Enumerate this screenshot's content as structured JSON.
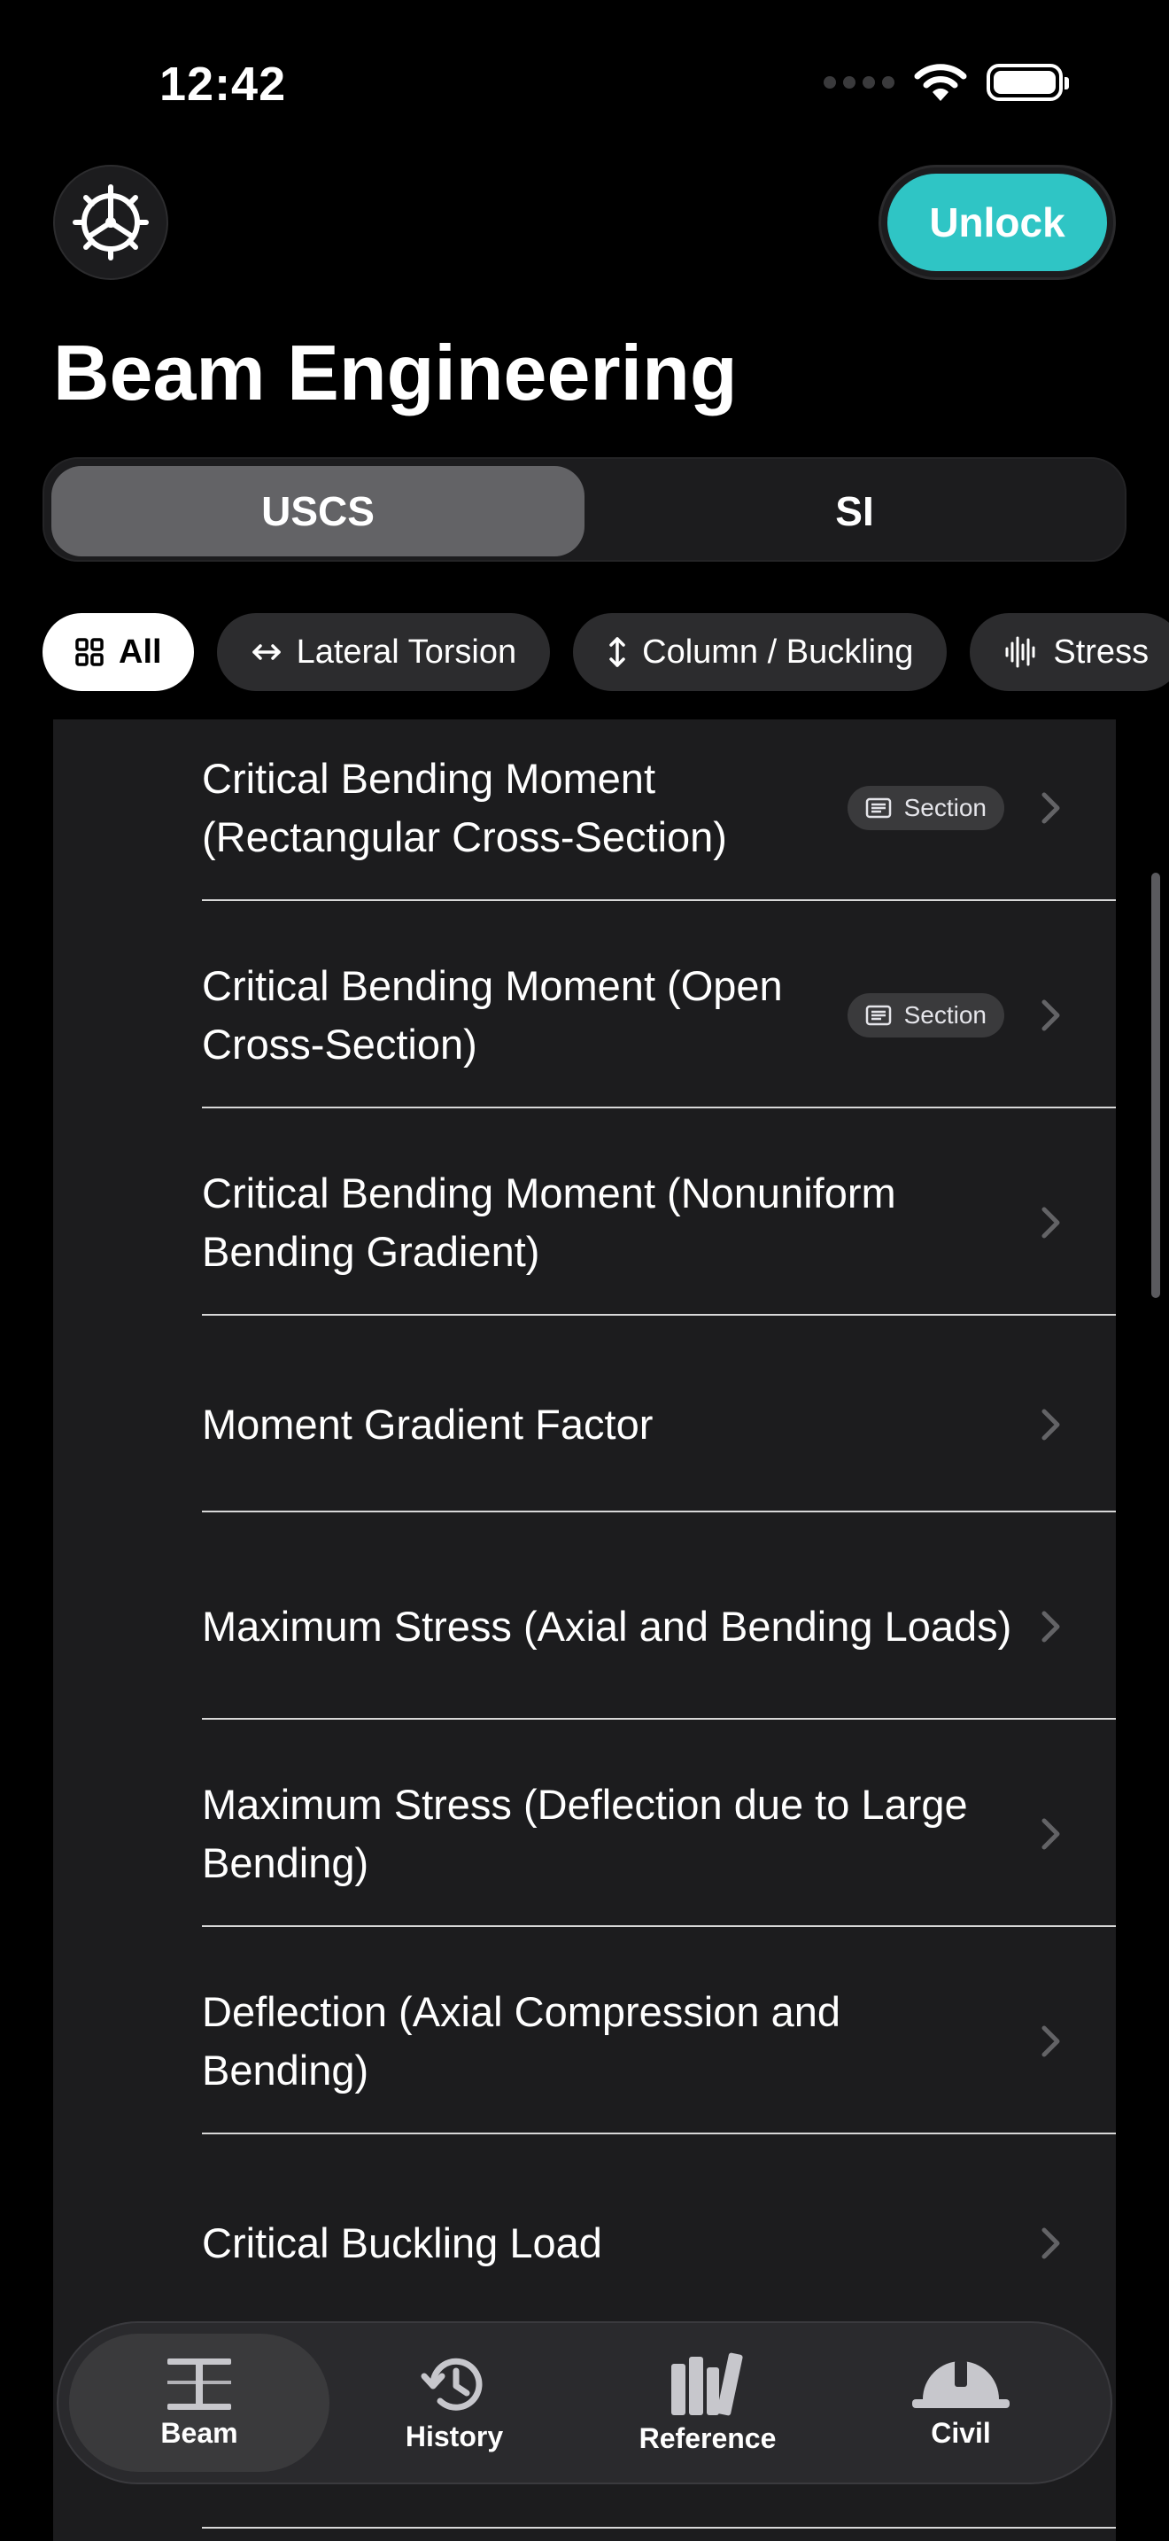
{
  "status": {
    "time": "12:42"
  },
  "header": {
    "unlock_label": "Unlock",
    "title": "Beam Engineering"
  },
  "units": {
    "options": [
      "USCS",
      "SI"
    ],
    "selected": "USCS"
  },
  "filters": [
    {
      "label": "All",
      "icon": "grid-icon",
      "active": true
    },
    {
      "label": "Lateral Torsion",
      "icon": "left-right-arrow-icon",
      "active": false
    },
    {
      "label": "Column / Buckling",
      "icon": "up-down-arrow-icon",
      "active": false
    },
    {
      "label": "Stress",
      "icon": "waveform-icon",
      "active": false
    }
  ],
  "items": [
    {
      "label": "Critical Bending Moment (Rectangular Cross-Section)",
      "badge": "Section"
    },
    {
      "label": "Critical Bending Moment (Open Cross-Section)",
      "badge": "Section"
    },
    {
      "label": "Critical Bending Moment (Nonuniform Bending Gradient)"
    },
    {
      "label": "Moment Gradient Factor"
    },
    {
      "label": "Maximum Stress (Axial and Bending Loads)"
    },
    {
      "label": "Maximum Stress (Deflection due to Large Bending)"
    },
    {
      "label": "Deflection (Axial Compression and Bending)"
    },
    {
      "label": "Critical Buckling Load"
    }
  ],
  "tabs": [
    {
      "label": "Beam",
      "icon": "i-beam-icon",
      "selected": true
    },
    {
      "label": "History",
      "icon": "history-icon",
      "selected": false
    },
    {
      "label": "Reference",
      "icon": "books-icon",
      "selected": false
    },
    {
      "label": "Civil",
      "icon": "hard-hat-icon",
      "selected": false
    }
  ],
  "colors": {
    "accent": "#2fc5c5",
    "background": "#000000",
    "card": "#1c1c1e"
  }
}
